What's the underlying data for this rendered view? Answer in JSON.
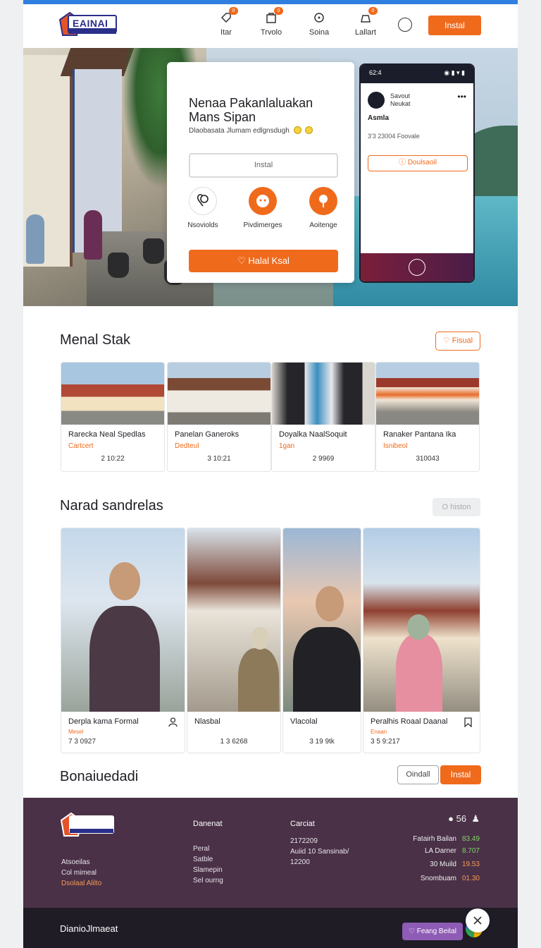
{
  "colors": {
    "accent": "#f06a1c",
    "brand": "#2a2f8a",
    "footer": "#4a3147",
    "topline": "#2f7fe0"
  },
  "header": {
    "logo_text": "EAINAI",
    "nav": [
      {
        "label": "Itar",
        "badge": "0",
        "icon": "tag-icon"
      },
      {
        "label": "Trvolo",
        "badge": "0",
        "icon": "bag-icon"
      },
      {
        "label": "Soina",
        "badge": "",
        "icon": "compass-icon"
      },
      {
        "label": "Lallart",
        "badge": "0",
        "icon": "bell-icon"
      }
    ],
    "install_label": "Instal"
  },
  "hero": {
    "title": "Nenaa Pakanlaluakan Mans Sipan",
    "subtitle": "Dlaobasata Jlumam edlgnsdugh",
    "input_placeholder": "Instal",
    "features": [
      {
        "label": "Nsoviolds",
        "icon": "heart-icon"
      },
      {
        "label": "Pivdimerges",
        "icon": "chat-icon"
      },
      {
        "label": "Aoitenge",
        "icon": "pin-icon"
      }
    ],
    "cta_label": "Halal Ksal"
  },
  "phone": {
    "time": "62:4",
    "account_name": "Savout",
    "account_sub": "Neukat",
    "headline": "Asmla",
    "meta": "3'3 23004 Foovale",
    "button_label": "Doulsaoil"
  },
  "section1": {
    "title": "Menal Stak",
    "button_label": "Fisual",
    "cards": [
      {
        "title": "Rarecka Neal Spedlas",
        "sub": "Cartcert",
        "num": "2 10:22"
      },
      {
        "title": "Panelan Ganeroks",
        "sub": "Dedteul",
        "num": "3 10:21"
      },
      {
        "title": "Doyalka NaalSoquit",
        "sub": "1gan",
        "num": "2 9969"
      },
      {
        "title": "Ranaker Pantana Ika",
        "sub": "Isnibeol",
        "num": "310043"
      }
    ]
  },
  "section2": {
    "title": "Narad sandrelas",
    "button_label": "O histon",
    "cards": [
      {
        "title": "Derpla kama Formal",
        "sub": "Mesel",
        "num": "7 3 0927"
      },
      {
        "title": "Nlasbal",
        "sub": "",
        "num": "1 3 6268"
      },
      {
        "title": "Vlacolal",
        "sub": "",
        "num": "3 19 9tk"
      },
      {
        "title": "Peralhis Roaal Daanal",
        "sub": "Enaan",
        "num": "3 5 9:217"
      }
    ]
  },
  "section3": {
    "title": "Bonaiuedadi",
    "outline_label": "Oindall",
    "fill_label": "Instal"
  },
  "footer": {
    "col1": [
      "Atsoeilas",
      "Col mimeal",
      "Dsolaal Alilto"
    ],
    "col2_head": "Danenat",
    "col2": [
      "Peral",
      "Satble",
      "Slamepin",
      "Sel ourng"
    ],
    "col3_head": "Carciat",
    "col3": [
      "2172209",
      "Auiid 10 Sansinab/",
      "12200"
    ],
    "count": "56",
    "stats": [
      {
        "label": "Fatairh Bailan",
        "value": "83.49",
        "color": "#7fd36a"
      },
      {
        "label": "LA Darner",
        "value": "8.707",
        "color": "#7fd36a"
      },
      {
        "label": "30 Muild",
        "value": "19.53",
        "color": "#f39a55"
      },
      {
        "label": "Snombuam",
        "value": "01.30",
        "color": "#f39a55"
      }
    ]
  },
  "bottom_bar": {
    "text": "DianioJlmaeat",
    "pill_label": "Feang Beital"
  }
}
